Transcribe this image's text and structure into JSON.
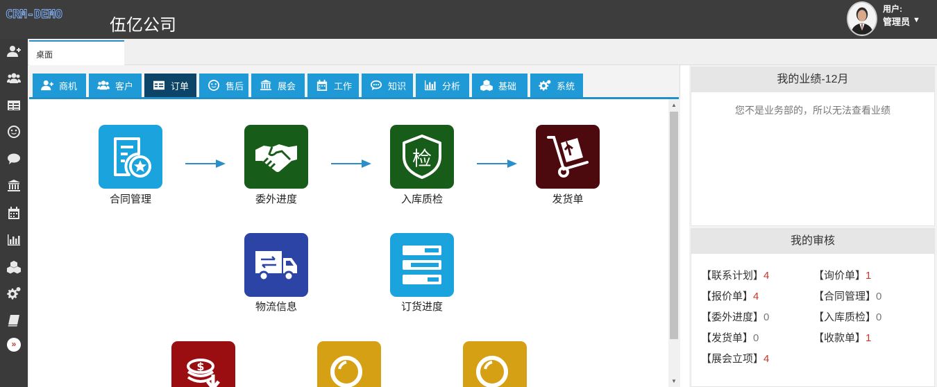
{
  "header": {
    "logo": "CRM-DEMO",
    "company": "伍亿公司",
    "user_label": "用户:",
    "user_name": "管理员"
  },
  "desk_tab": "桌面",
  "nav_tabs": [
    {
      "label": "商机",
      "icon": "user-plus-icon"
    },
    {
      "label": "客户",
      "icon": "users-icon"
    },
    {
      "label": "订单",
      "icon": "table-icon",
      "active": true
    },
    {
      "label": "售后",
      "icon": "smile-icon"
    },
    {
      "label": "展会",
      "icon": "bank-icon"
    },
    {
      "label": "工作",
      "icon": "calendar-icon"
    },
    {
      "label": "知识",
      "icon": "comment-icon"
    },
    {
      "label": "分析",
      "icon": "bar-chart-icon"
    },
    {
      "label": "基础",
      "icon": "cubes-icon"
    },
    {
      "label": "系统",
      "icon": "gears-icon"
    }
  ],
  "tiles": [
    {
      "label": "合同管理",
      "color": "#1aa3dc",
      "icon": "contract-icon"
    },
    {
      "label": "委外进度",
      "color": "#175c18",
      "icon": "handshake-icon"
    },
    {
      "label": "入库质检",
      "color": "#175c18",
      "icon": "inspection-shield-icon",
      "glyph": "检"
    },
    {
      "label": "发货单",
      "color": "#4c0a0e",
      "icon": "hand-truck-icon"
    },
    {
      "label": "物流信息",
      "color": "#2b44a6",
      "icon": "truck-icon"
    },
    {
      "label": "订货进度",
      "color": "#1aa3dc",
      "icon": "progress-bars-icon"
    },
    {
      "label": "",
      "color": "#9a0e12",
      "icon": "money-down-icon"
    },
    {
      "label": "",
      "color": "#d6a014",
      "icon": "magnifier-icon"
    },
    {
      "label": "",
      "color": "#d6a014",
      "icon": "magnifier-icon"
    }
  ],
  "performance": {
    "title": "我的业绩-12月",
    "message": "您不是业务部的，所以无法查看业绩"
  },
  "audit": {
    "title": "我的审核",
    "items": [
      {
        "label": "【联系计划】",
        "count": "4",
        "highlight": true
      },
      {
        "label": "【询价单】",
        "count": "1",
        "highlight": true
      },
      {
        "label": "【报价单】",
        "count": "4",
        "highlight": true
      },
      {
        "label": "【合同管理】",
        "count": "0",
        "highlight": false
      },
      {
        "label": "【委外进度】",
        "count": "0",
        "highlight": false
      },
      {
        "label": "【入库质检】",
        "count": "0",
        "highlight": false
      },
      {
        "label": "【发货单】",
        "count": "0",
        "highlight": false
      },
      {
        "label": "【收款单】",
        "count": "1",
        "highlight": true
      },
      {
        "label": "【展会立项】",
        "count": "4",
        "highlight": true
      }
    ]
  },
  "colors": {
    "header_bg": "#3d3d3d",
    "nav_blue": "#1f9ad6",
    "nav_active": "#0d4568",
    "count_red": "#c0392b"
  }
}
